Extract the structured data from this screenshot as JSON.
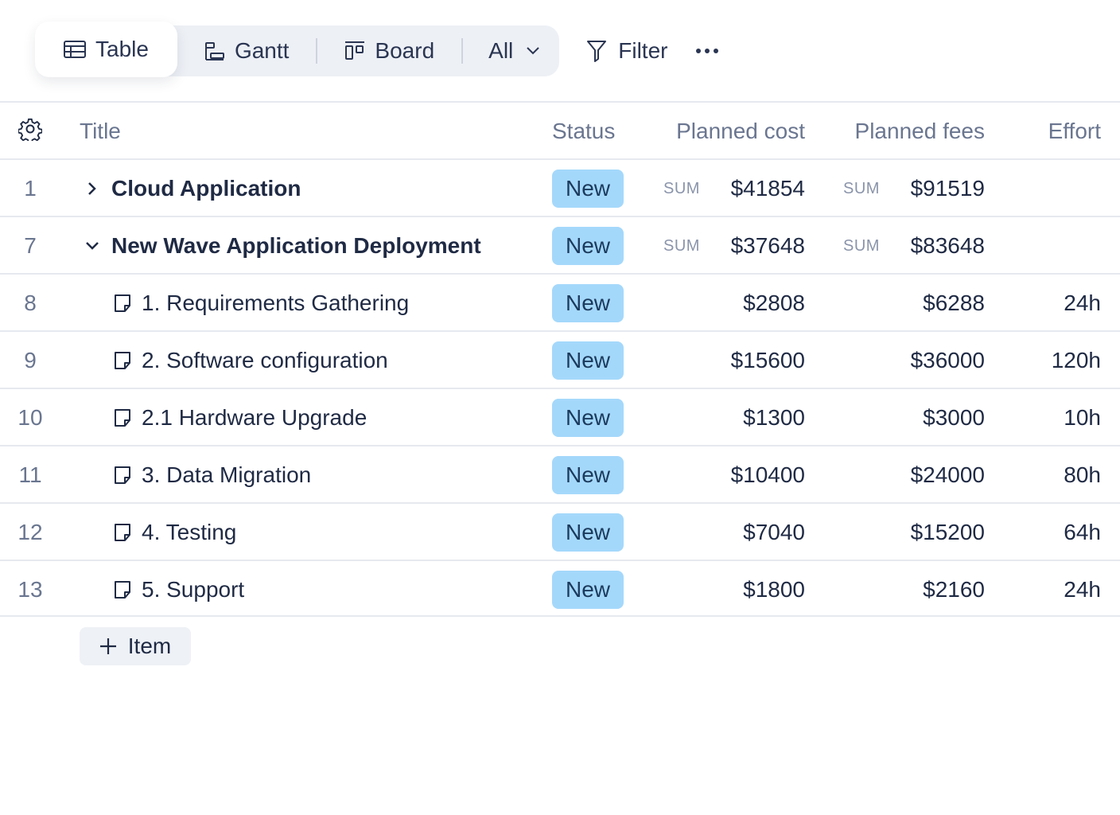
{
  "toolbar": {
    "views": [
      {
        "label": "Table",
        "icon": "table-icon",
        "active": true
      },
      {
        "label": "Gantt",
        "icon": "gantt-icon",
        "active": false
      },
      {
        "label": "Board",
        "icon": "board-icon",
        "active": false
      }
    ],
    "filter_scope": "All",
    "filter_label": "Filter"
  },
  "columns": {
    "title": "Title",
    "status": "Status",
    "planned_cost": "Planned cost",
    "planned_fees": "Planned fees",
    "effort": "Effort"
  },
  "sum_label": "SUM",
  "rows": [
    {
      "num": "1",
      "title": "Cloud Application",
      "type": "group",
      "expanded": false,
      "status": "New",
      "planned_cost": "$41854",
      "planned_fees": "$91519",
      "effort": ""
    },
    {
      "num": "7",
      "title": "New Wave Application Deployment",
      "type": "group",
      "expanded": true,
      "status": "New",
      "planned_cost": "$37648",
      "planned_fees": "$83648",
      "effort": ""
    },
    {
      "num": "8",
      "title": "1. Requirements Gathering",
      "type": "task",
      "status": "New",
      "planned_cost": "$2808",
      "planned_fees": "$6288",
      "effort": "24h"
    },
    {
      "num": "9",
      "title": "2. Software configuration",
      "type": "task",
      "status": "New",
      "planned_cost": "$15600",
      "planned_fees": "$36000",
      "effort": "120h"
    },
    {
      "num": "10",
      "title": "2.1 Hardware Upgrade",
      "type": "task",
      "status": "New",
      "planned_cost": "$1300",
      "planned_fees": "$3000",
      "effort": "10h"
    },
    {
      "num": "11",
      "title": "3. Data Migration",
      "type": "task",
      "status": "New",
      "planned_cost": "$10400",
      "planned_fees": "$24000",
      "effort": "80h"
    },
    {
      "num": "12",
      "title": "4. Testing",
      "type": "task",
      "status": "New",
      "planned_cost": "$7040",
      "planned_fees": "$15200",
      "effort": "64h"
    },
    {
      "num": "13",
      "title": "5. Support",
      "type": "task",
      "status": "New",
      "planned_cost": "$1800",
      "planned_fees": "$2160",
      "effort": "24h"
    }
  ],
  "add_item_label": "Item",
  "colors": {
    "status_badge_bg": "#a4d8fb",
    "toolbar_bg": "#edf0f5",
    "header_text": "#6a7690"
  }
}
